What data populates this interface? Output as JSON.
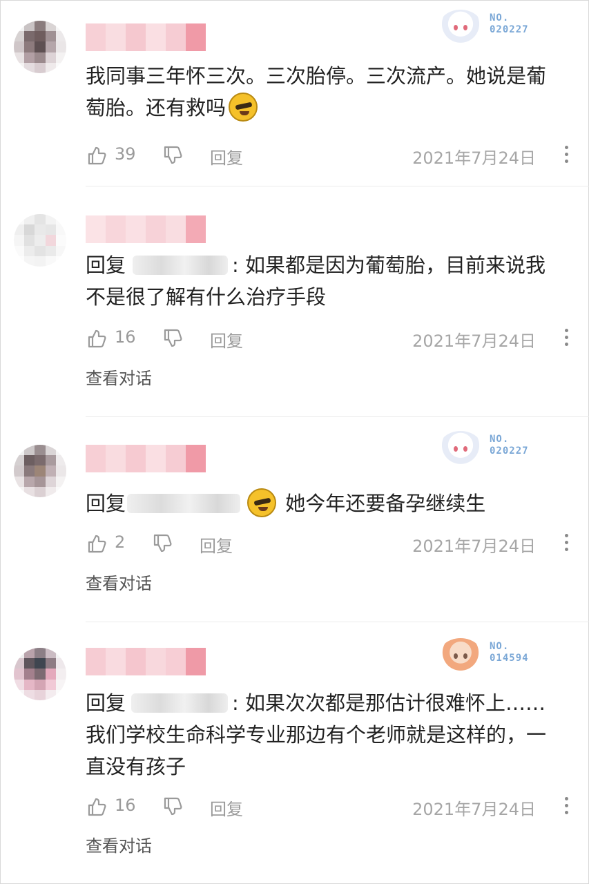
{
  "colors": {
    "text": "#222222",
    "meta": "#a6a6a6",
    "action": "#9a9a9a",
    "divider": "#ebebeb",
    "emoji": "#f5c12a",
    "badge_text": "#7aa7d6",
    "name_mosaic": "#f6c9d0"
  },
  "comments": [
    {
      "badge": {
        "line1": "NO.",
        "line2": "020227"
      },
      "body": {
        "text": "我同事三年怀三次。三次胎停。三次流产。她说是葡萄胎。还有救吗"
      },
      "likes": "39",
      "reply_label": "回复",
      "date": "2021年7月24日"
    },
    {
      "body": {
        "prefix": "回复",
        "after_name": ": 如果都是因为葡萄胎，目前来说我不是很了解有什么治疗手段"
      },
      "likes": "16",
      "reply_label": "回复",
      "date": "2021年7月24日",
      "view_conversation": "查看对话"
    },
    {
      "badge": {
        "line1": "NO.",
        "line2": "020227"
      },
      "body": {
        "prefix": "回复",
        "after_name": "她今年还要备孕继续生"
      },
      "likes": "2",
      "reply_label": "回复",
      "date": "2021年7月24日",
      "view_conversation": "查看对话"
    },
    {
      "badge": {
        "line1": "NO.",
        "line2": "014594"
      },
      "body": {
        "prefix": "回复",
        "after_name": ": 如果次次都是那估计很难怀上……我们学校生命科学专业那边有个老师就是这样的，一直没有孩子"
      },
      "likes": "16",
      "reply_label": "回复",
      "date": "2021年7月24日",
      "view_conversation": "查看对话"
    }
  ]
}
